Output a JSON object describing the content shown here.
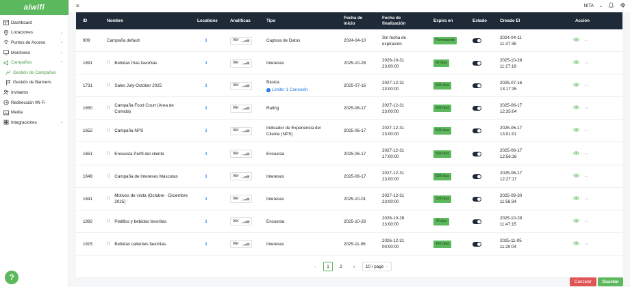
{
  "brand": {
    "logo_text": "aiwifi"
  },
  "sidebar": {
    "items": [
      {
        "label": "Dashboard",
        "icon": "grid-icon",
        "chevron": false
      },
      {
        "label": "Locaciones",
        "icon": "location-pin-icon",
        "chevron": true
      },
      {
        "label": "Puntos de Acceso",
        "icon": "access-point-icon",
        "chevron": true
      },
      {
        "label": "Monitoreo",
        "icon": "monitor-icon",
        "chevron": true
      },
      {
        "label": "Campañas",
        "icon": "megaphone-icon",
        "chevron": true,
        "open": true
      },
      {
        "label": "Gestión de Campañas",
        "icon": "campaign-chart-icon",
        "sub": true,
        "active": true
      },
      {
        "label": "Gestión de Banners",
        "icon": "banner-flag-icon",
        "sub": true
      },
      {
        "label": "Invitados",
        "icon": "users-icon",
        "chevron": false
      },
      {
        "label": "Redirección Wi-Fi",
        "icon": "redirect-icon",
        "chevron": false
      },
      {
        "label": "Media",
        "icon": "media-icon",
        "chevron": false
      },
      {
        "label": "Integraciones",
        "icon": "plug-icon",
        "chevron": true
      }
    ],
    "help_label": "?"
  },
  "topbar": {
    "menu_icon": "≡",
    "user": "NITA"
  },
  "table": {
    "headers": {
      "id": "ID",
      "name": "Nombre",
      "locations": "Locations",
      "analytics": "Analíticas",
      "type": "Tipo",
      "start": "Fecha de inicio",
      "end": "Fecha de finalización",
      "expires": "Expira en",
      "status": "Estado",
      "created": "Creado El",
      "action": "Acción"
    },
    "ver_label": "Ver",
    "rows": [
      {
        "id": "909",
        "name": "Campaña default",
        "draggable": false,
        "locations": "3",
        "type": "Captura de Datos",
        "start": "2024-04-10",
        "end": "Sin fecha de expiración",
        "expires": "Permanente",
        "created": "2024-04-11 11:37:35"
      },
      {
        "id": "1891",
        "name": "Bebidas frías favoritas",
        "draggable": true,
        "locations": "3",
        "type": "Intereses",
        "start": "2025-10-28",
        "end": "2026-10-31 23:00:00",
        "expires": "92 días",
        "created": "2025-10-28 11:27:19"
      },
      {
        "id": "1731",
        "name": "Sales July-October 2025",
        "draggable": true,
        "locations": "3",
        "type": "Básica",
        "type_note": "Límite: 1 Conexión",
        "start": "2025-07-16",
        "end": "2027-12-31 23:00:00",
        "expires": "509 días",
        "created": "2025-07-16 13:17:35"
      },
      {
        "id": "1650",
        "name": "Campaña Food Court (Area de Comida)",
        "draggable": true,
        "locations": "3",
        "type": "Rating",
        "start": "2025-06-17",
        "end": "2027-12-31 23:00:00",
        "expires": "509 días",
        "created": "2025-06-17 12:35:04"
      },
      {
        "id": "1652",
        "name": "Campaña NPS",
        "draggable": true,
        "locations": "3",
        "type": "Indicador de Experiencia del Cliente (NPS)",
        "start": "2025-06-17",
        "end": "2027-12-31 23:00:00",
        "expires": "509 días",
        "created": "2025-06-17 13:01:01"
      },
      {
        "id": "1651",
        "name": "Encuesta Perfil del cliente",
        "draggable": true,
        "locations": "3",
        "type": "Encuesta",
        "start": "2025-06-17",
        "end": "2027-12-31 17:00:00",
        "expires": "509 días",
        "created": "2025-06-17 12:56:16"
      },
      {
        "id": "1649",
        "name": "Campaña de Intereses Mascotas",
        "draggable": true,
        "locations": "3",
        "type": "Intereses",
        "start": "2025-06-17",
        "end": "2027-12-31 23:00:00",
        "expires": "509 días",
        "created": "2025-06-17 12:27:17"
      },
      {
        "id": "1841",
        "name": "Motivos de visita (Octubre - Diciembre 2025)",
        "draggable": true,
        "locations": "3",
        "type": "Intereses",
        "start": "2025-10-01",
        "end": "2027-12-31 23:00:00",
        "expires": "509 días",
        "created": "2025-09-30 11:56:34"
      },
      {
        "id": "1892",
        "name": "Platillos y bebidas favoritas",
        "draggable": true,
        "locations": "3",
        "type": "Encuesta",
        "start": "2025-10-28",
        "end": "2026-10-28 23:00:00",
        "expires": "78 días",
        "created": "2025-10-28 11:47:15"
      },
      {
        "id": "1915",
        "name": "Bebidas calientes favoritas",
        "draggable": true,
        "locations": "3",
        "type": "Intereses",
        "start": "2025-11-06",
        "end": "2026-12-31 00:00:00",
        "expires": "142 días",
        "created": "2025-11-05 11:20:04"
      }
    ]
  },
  "pagination": {
    "pages": [
      "1",
      "2"
    ],
    "current": "1",
    "page_size": "10 / page"
  },
  "footer": {
    "cancel_label": "Cancelar",
    "save_label": "Guardar"
  },
  "colors": {
    "accent": "#5cb85c",
    "header_bg": "#1e2a38",
    "link": "#1a73e8",
    "danger": "#e05656"
  }
}
